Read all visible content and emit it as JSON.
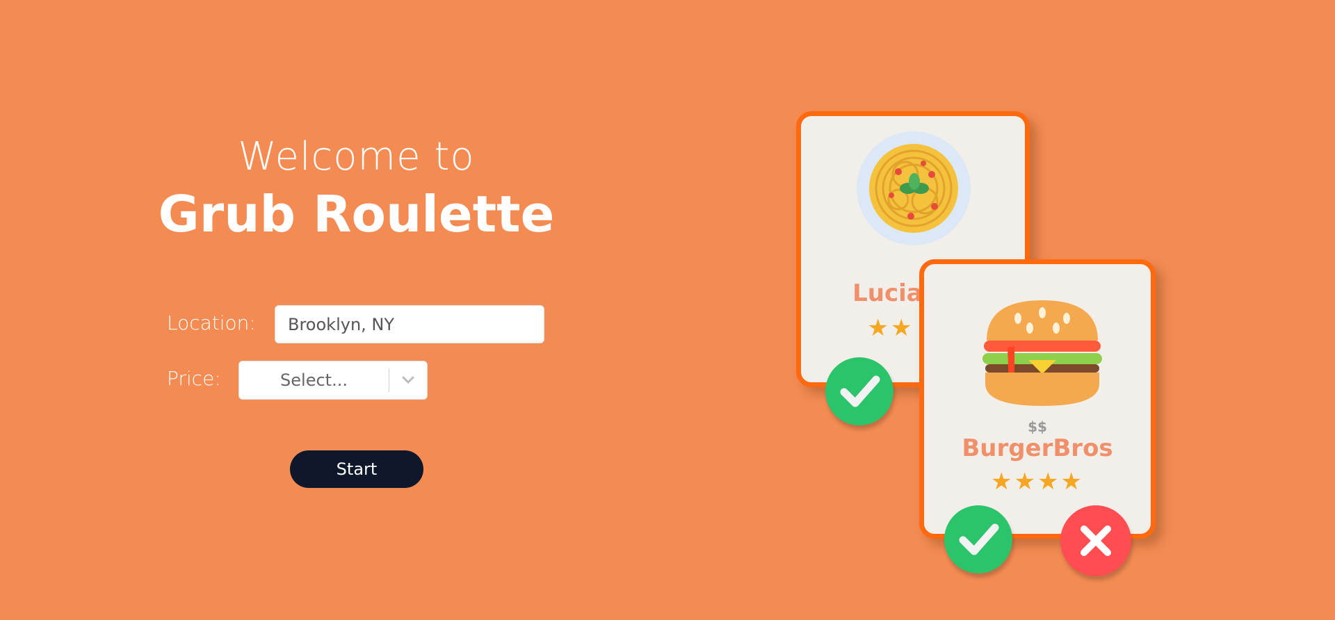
{
  "hero": {
    "welcome": "Welcome to",
    "title": "Grub Roulette"
  },
  "form": {
    "location_label": "Location:",
    "location_value": "Brooklyn, NY",
    "price_label": "Price:",
    "price_placeholder": "Select...",
    "start_label": "Start"
  },
  "cards": [
    {
      "price": "$$$",
      "name": "Lucia’s",
      "stars": "★★",
      "image_icon": "pasta-plate-icon"
    },
    {
      "price": "$$",
      "name": "BurgerBros",
      "stars": "★★★★",
      "image_icon": "burger-icon"
    }
  ],
  "colors": {
    "background": "#f38b53",
    "card_border": "#ff6a10",
    "approve": "#2cc46b",
    "reject": "#ff4d52",
    "button": "#0f172a"
  }
}
